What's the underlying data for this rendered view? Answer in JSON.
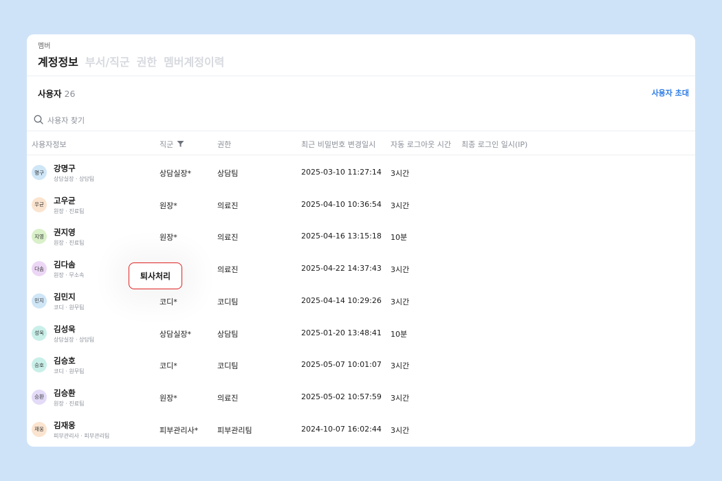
{
  "breadcrumb": "멤버",
  "tabs": [
    "계정정보",
    "부서/직군",
    "권한",
    "멤버계정이력"
  ],
  "section": {
    "title": "사용자",
    "count": "26",
    "invite_label": "사용자 초대"
  },
  "search": {
    "placeholder": "사용자 찾기"
  },
  "columns": [
    "사용자정보",
    "직군",
    "권한",
    "최근 비밀번호 변경일시",
    "자동 로그아웃 시간",
    "최종 로그인 일시(IP)"
  ],
  "rows": [
    {
      "avatar": "명구",
      "avatar_color": "#cfe6f7",
      "name": "강명구",
      "sub": "상담실장 · 상담팀",
      "job": "상담실장*",
      "role": "상담팀",
      "pw_changed": "2025-03-10 11:27:14",
      "logout": "3시간"
    },
    {
      "avatar": "우균",
      "avatar_color": "#fbe4cf",
      "name": "고우균",
      "sub": "원장 · 진료팀",
      "job": "원장*",
      "role": "의료진",
      "pw_changed": "2025-04-10 10:36:54",
      "logout": "3시간"
    },
    {
      "avatar": "지영",
      "avatar_color": "#d9f0c9",
      "name": "권지영",
      "sub": "원장 · 진료팀",
      "job": "원장*",
      "role": "의료진",
      "pw_changed": "2025-04-16 13:15:18",
      "logout": "10분"
    },
    {
      "avatar": "다솜",
      "avatar_color": "#ecd6f5",
      "name": "김다솜",
      "sub": "원장 · 무소속",
      "job": "",
      "role": "의료진",
      "pw_changed": "2025-04-22 14:37:43",
      "logout": "3시간"
    },
    {
      "avatar": "민지",
      "avatar_color": "#cfe6f7",
      "name": "김민지",
      "sub": "코디 · 원무팀",
      "job": "코디*",
      "role": "코디팀",
      "pw_changed": "2025-04-14 10:29:26",
      "logout": "3시간"
    },
    {
      "avatar": "성욱",
      "avatar_color": "#c9efe9",
      "name": "김성욱",
      "sub": "상담실장 · 상담팀",
      "job": "상담실장*",
      "role": "상담팀",
      "pw_changed": "2025-01-20 13:48:41",
      "logout": "10분"
    },
    {
      "avatar": "승호",
      "avatar_color": "#c9efe9",
      "name": "김승호",
      "sub": "코디 · 원무팀",
      "job": "코디*",
      "role": "코디팀",
      "pw_changed": "2025-05-07 10:01:07",
      "logout": "3시간"
    },
    {
      "avatar": "승환",
      "avatar_color": "#e3dbf7",
      "name": "김승환",
      "sub": "원장 · 진료팀",
      "job": "원장*",
      "role": "의료진",
      "pw_changed": "2025-05-02 10:57:59",
      "logout": "3시간"
    },
    {
      "avatar": "재웅",
      "avatar_color": "#fbe4cf",
      "name": "김재웅",
      "sub": "피부관리사 · 피부관리팀",
      "job": "피부관리사*",
      "role": "피부관리팀",
      "pw_changed": "2024-10-07 16:02:44",
      "logout": "3시간"
    }
  ],
  "popup": {
    "label": "퇴사처리"
  },
  "icons": {
    "search": "search-icon",
    "filter": "filter-icon"
  },
  "colors": {
    "accent": "#2b7be4",
    "popup_border": "#e02020"
  }
}
